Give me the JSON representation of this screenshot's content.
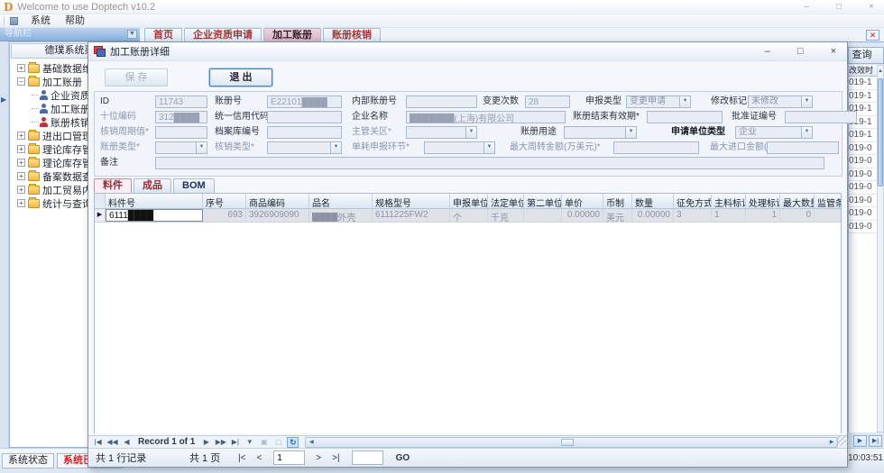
{
  "window": {
    "title": "Welcome to use Doptech v10.2",
    "time": "10:03:51",
    "controls": {
      "minimize": "–",
      "maximize": "□",
      "close": "×"
    }
  },
  "menubar": {
    "items": [
      "系统",
      "帮助"
    ]
  },
  "sidebar": {
    "header": "导航栏",
    "root_button": "德璞系统菜单",
    "items": [
      {
        "label": "基础数据维护"
      },
      {
        "label": "加工账册【N】"
      },
      {
        "label": "企业资质申请"
      },
      {
        "label": "加工账册备案"
      },
      {
        "label": "账册核销"
      },
      {
        "label": "进出口管理"
      },
      {
        "label": "理论库存管理【核"
      },
      {
        "label": "理论库存管理【单"
      },
      {
        "label": "备案数据查询"
      },
      {
        "label": "加工贸易内销"
      },
      {
        "label": "统计与查询"
      }
    ]
  },
  "tabstrip": {
    "tabs": [
      "首页",
      "企业资质申请",
      "加工账册",
      "账册核销"
    ]
  },
  "background": {
    "query_button": "查询",
    "partial_column_header": "改效时",
    "rows": [
      "019-1",
      "019-1",
      "019-1",
      "019-1",
      "019-1",
      "019-0",
      "019-0",
      "019-0",
      "019-0",
      "019-0",
      "019-0",
      "019-0"
    ]
  },
  "dialog": {
    "title": "加工账册详细",
    "toolbar": {
      "save": "保 存",
      "exit": "退 出"
    },
    "form": {
      "id": {
        "label": "ID",
        "value": "11743"
      },
      "book_no": {
        "label": "账册号",
        "value": "E22101████"
      },
      "internal_no": {
        "label": "内部账册号",
        "value": ""
      },
      "change_count": {
        "label": "变更次数",
        "value": "28"
      },
      "declare_type": {
        "label": "申报类型",
        "value": "变更申请"
      },
      "modify_flag": {
        "label": "修改标记",
        "value": "未修改"
      },
      "ten_code": {
        "label": "十位编码",
        "value": "312████"
      },
      "credit_code": {
        "label": "统一信用代码",
        "value": ""
      },
      "company": {
        "label": "企业名称",
        "value": "███████(上海)有限公司"
      },
      "end_date": {
        "label": "账册结束有效期*",
        "value": ""
      },
      "approval_no": {
        "label": "批准证编号",
        "value": ""
      },
      "verify_cycle": {
        "label": "核销周期值*",
        "value": ""
      },
      "archive_no": {
        "label": "档案库编号",
        "value": ""
      },
      "customs_district": {
        "label": "主管关区*",
        "value": ""
      },
      "book_usage": {
        "label": "账册用途",
        "value": ""
      },
      "apply_unit_type": {
        "label": "申请单位类型",
        "value": "企业"
      },
      "book_type": {
        "label": "账册类型*",
        "value": ""
      },
      "verify_type": {
        "label": "核销类型*",
        "value": ""
      },
      "consumption_stage": {
        "label": "单耗申报环节*",
        "value": ""
      },
      "max_turnover": {
        "label": "最大周转金额(万美元)*",
        "value": ""
      },
      "max_import": {
        "label": "最大进口金额(万美元)*",
        "value": ""
      },
      "remark": {
        "label": "备注",
        "value": ""
      }
    },
    "tabs": [
      "料件",
      "成品",
      "BOM"
    ],
    "grid": {
      "columns": [
        "料件号",
        "序号",
        "商品编码",
        "品名",
        "规格型号",
        "申报单位",
        "法定单位",
        "第二单位",
        "单价",
        "币制",
        "数量",
        "征免方式",
        "主料标记",
        "处理标记",
        "最大数量",
        "监管条件"
      ],
      "row": [
        "6111████",
        "693",
        "3926909090",
        "████外壳",
        "6111225FW2",
        "个",
        "千克",
        "",
        "0.00000",
        "美元",
        "0.00000",
        "3",
        "1",
        "1",
        "0",
        ""
      ]
    },
    "navigator": {
      "record": "Record 1 of 1"
    },
    "pager": {
      "rows_total": "共 1 行记录",
      "pages_total": "共 1 页",
      "first": "|<",
      "prev": "<",
      "page": "1",
      "next": ">",
      "last": ">|",
      "go_page": "",
      "go": "GO"
    }
  },
  "statusbar": {
    "label": "系统状态",
    "message": "系统已就绪!"
  }
}
